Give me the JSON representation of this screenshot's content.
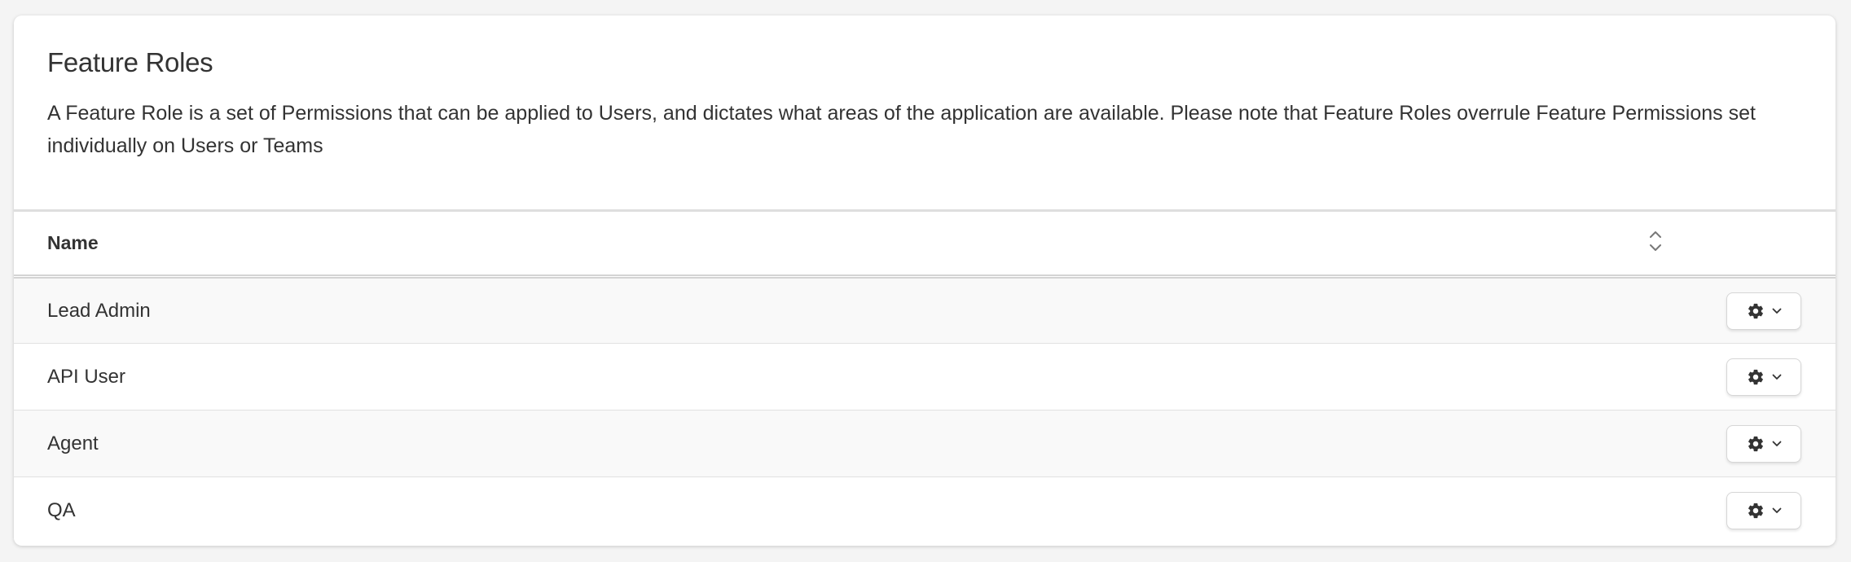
{
  "panel": {
    "title": "Feature Roles",
    "description": "A Feature Role is a set of Permissions that can be applied to Users, and dictates what areas of the application are available. Please note that Feature Roles overrule Feature Permissions set individually on Users or Teams"
  },
  "table": {
    "columns": [
      {
        "label": "Name",
        "sort_icon": "sort-icon"
      }
    ],
    "rows": [
      {
        "name": "Lead Admin",
        "action_icon": "gear-icon"
      },
      {
        "name": "API User",
        "action_icon": "gear-icon"
      },
      {
        "name": "Agent",
        "action_icon": "gear-icon"
      },
      {
        "name": "QA",
        "action_icon": "gear-icon"
      }
    ]
  },
  "colors": {
    "text": "#333333",
    "stripe": "#f9f9f9",
    "border": "#e1e1e1"
  }
}
